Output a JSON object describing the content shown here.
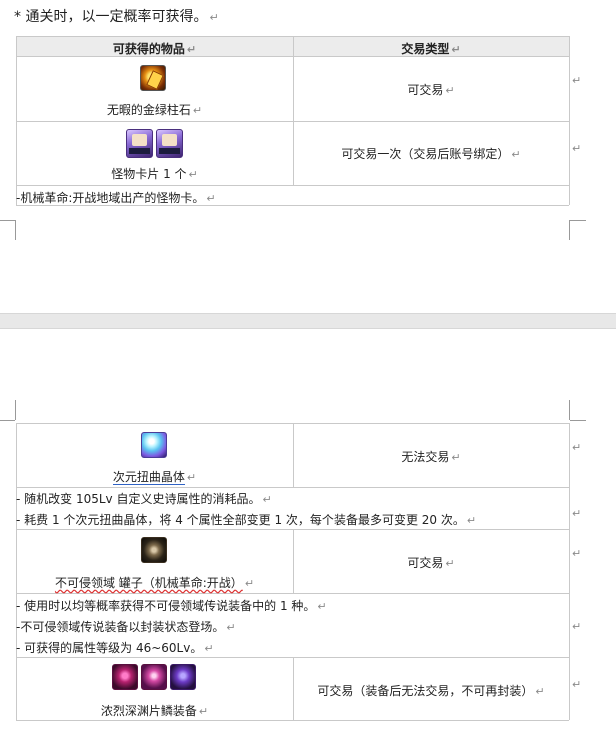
{
  "heading": {
    "text": "*  通关时，以一定概率可获得。"
  },
  "table1": {
    "col_item": "可获得的物品",
    "col_trade": "交易类型",
    "rows": [
      {
        "item": "无暇的金绿柱石",
        "trade": "可交易",
        "icon": "golden-gem-icon"
      },
      {
        "item": "怪物卡片 1 个",
        "trade": "可交易一次（交易后账号绑定）",
        "icon": "monster-card-icon"
      }
    ],
    "note": "-机械革命:开战地域出产的怪物卡。"
  },
  "table2": {
    "rows": [
      {
        "item": "次元扭曲晶体",
        "trade": "无法交易",
        "icon": "dimension-cube-icon",
        "notes": [
          "-  随机改变 105Lv 自定义史诗属性的消耗品。",
          "-  耗费 1 个次元扭曲晶体，将 4 个属性全部变更 1 次，每个装备最多可变更 20 次。"
        ]
      },
      {
        "item": "不可侵领域 罐子（机械革命:开战）",
        "trade": "可交易",
        "icon": "jar-icon",
        "notes": [
          "-  使用时以均等概率获得不可侵领域传说装备中的 1 种。",
          "-不可侵领域传说装备以封装状态登场。",
          "-  可获得的属性等级为 46~60Lv。"
        ]
      },
      {
        "item": "浓烈深渊片鳞装备",
        "trade": "可交易（装备后无法交易，不可再封装）",
        "icon": "abyss-equipment-icon"
      }
    ]
  },
  "marks": {
    "paragraph": "↵"
  }
}
